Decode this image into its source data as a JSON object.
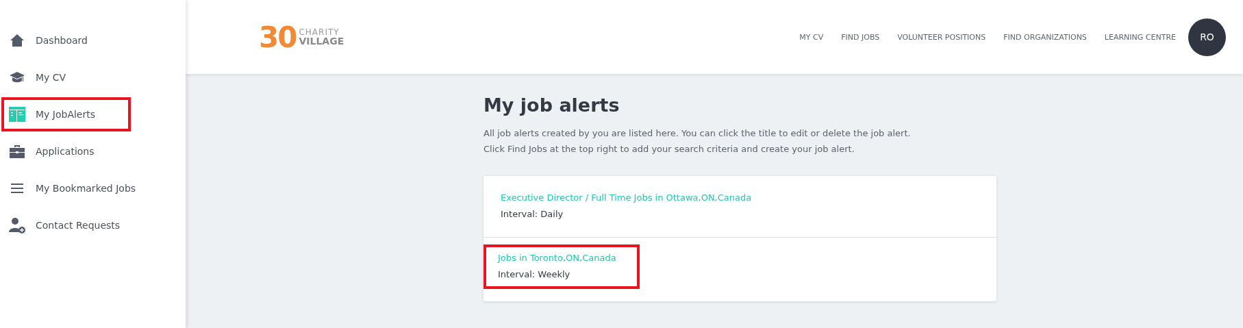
{
  "sidebar": {
    "items": [
      {
        "label": "Dashboard",
        "highlighted": false
      },
      {
        "label": "My CV",
        "highlighted": false
      },
      {
        "label": "My JobAlerts",
        "highlighted": true
      },
      {
        "label": "Applications",
        "highlighted": false
      },
      {
        "label": "My Bookmarked Jobs",
        "highlighted": false
      },
      {
        "label": "Contact Requests",
        "highlighted": false
      }
    ]
  },
  "header": {
    "logo": {
      "number": "30",
      "line_1": "CHARITY",
      "line_2": "VILLAGE"
    },
    "nav": [
      "MY CV",
      "FIND JOBS",
      "VOLUNTEER POSITIONS",
      "FIND ORGANIZATIONS",
      "LEARNING CENTRE"
    ],
    "avatar": "RO"
  },
  "page": {
    "title": "My job alerts",
    "intro": [
      "All job alerts created by you are listed here. You can click the title to edit or delete the job alert.",
      "Click Find Jobs at the top right to add your search criteria and create your job alert."
    ],
    "alerts": [
      {
        "title": "Executive Director / Full Time Jobs in Ottawa,ON,Canada",
        "interval": "Interval: Daily",
        "highlighted": false
      },
      {
        "title": "Jobs in Toronto,ON,Canada",
        "interval": "Interval: Weekly",
        "highlighted": true
      }
    ]
  }
}
